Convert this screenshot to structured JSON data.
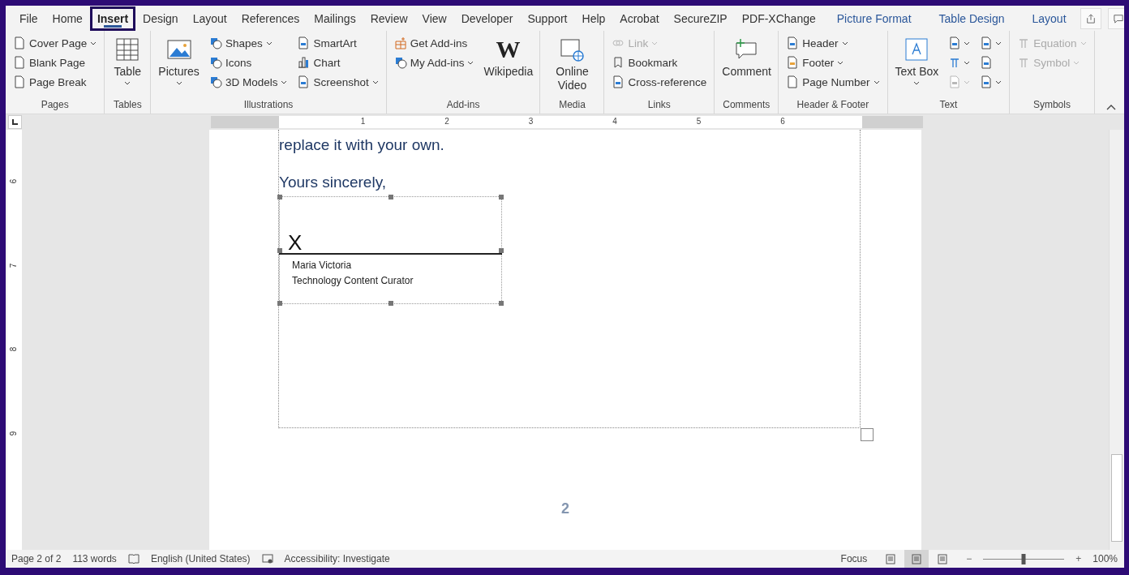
{
  "tabs": [
    {
      "label": "File",
      "kind": "normal",
      "selected": false
    },
    {
      "label": "Home",
      "kind": "normal",
      "selected": false
    },
    {
      "label": "Insert",
      "kind": "normal",
      "selected": true
    },
    {
      "label": "Design",
      "kind": "normal",
      "selected": false
    },
    {
      "label": "Layout",
      "kind": "normal",
      "selected": false
    },
    {
      "label": "References",
      "kind": "normal",
      "selected": false
    },
    {
      "label": "Mailings",
      "kind": "normal",
      "selected": false
    },
    {
      "label": "Review",
      "kind": "normal",
      "selected": false
    },
    {
      "label": "View",
      "kind": "normal",
      "selected": false
    },
    {
      "label": "Developer",
      "kind": "normal",
      "selected": false
    },
    {
      "label": "Support",
      "kind": "normal",
      "selected": false
    },
    {
      "label": "Help",
      "kind": "normal",
      "selected": false
    },
    {
      "label": "Acrobat",
      "kind": "normal",
      "selected": false
    },
    {
      "label": "SecureZIP",
      "kind": "normal",
      "selected": false
    },
    {
      "label": "PDF-XChange",
      "kind": "normal",
      "selected": false
    },
    {
      "label": "Picture Format",
      "kind": "contextual",
      "selected": false
    },
    {
      "label": "Table Design",
      "kind": "contextual",
      "selected": false
    },
    {
      "label": "Layout",
      "kind": "contextual",
      "selected": false
    }
  ],
  "ribbon": [
    {
      "label": "Pages",
      "columns": [
        [
          {
            "kind": "small",
            "label": "Cover Page",
            "dropdown": true,
            "disabled": false
          },
          {
            "kind": "small",
            "label": "Blank Page",
            "dropdown": false,
            "disabled": false
          },
          {
            "kind": "small",
            "label": "Page Break",
            "dropdown": false,
            "disabled": false
          }
        ]
      ]
    },
    {
      "label": "Tables",
      "columns": [
        [
          {
            "kind": "large",
            "label": "Table",
            "dropdown": true,
            "disabled": false
          }
        ]
      ]
    },
    {
      "label": "Illustrations",
      "columns": [
        [
          {
            "kind": "large",
            "label": "Pictures",
            "dropdown": true,
            "disabled": false
          }
        ],
        [
          {
            "kind": "small",
            "label": "Shapes",
            "dropdown": true,
            "disabled": false
          },
          {
            "kind": "small",
            "label": "Icons",
            "dropdown": false,
            "disabled": false
          },
          {
            "kind": "small",
            "label": "3D Models",
            "dropdown": true,
            "disabled": false
          }
        ],
        [
          {
            "kind": "small",
            "label": "SmartArt",
            "dropdown": false,
            "disabled": false
          },
          {
            "kind": "small",
            "label": "Chart",
            "dropdown": false,
            "disabled": false
          },
          {
            "kind": "small",
            "label": "Screenshot",
            "dropdown": true,
            "disabled": false
          }
        ]
      ]
    },
    {
      "label": "Add-ins",
      "columns": [
        [
          {
            "kind": "small",
            "label": "Get Add-ins",
            "dropdown": false,
            "disabled": false
          },
          {
            "kind": "small",
            "label": "My Add-ins",
            "dropdown": true,
            "disabled": false
          }
        ],
        [
          {
            "kind": "large",
            "label": "Wikipedia",
            "logo": "W",
            "dropdown": false,
            "disabled": false
          }
        ]
      ]
    },
    {
      "label": "Media",
      "columns": [
        [
          {
            "kind": "large",
            "label": "Online Video",
            "dropdown": false,
            "disabled": false
          }
        ]
      ]
    },
    {
      "label": "Links",
      "columns": [
        [
          {
            "kind": "small",
            "label": "Link",
            "dropdown": true,
            "disabled": true
          },
          {
            "kind": "small",
            "label": "Bookmark",
            "dropdown": false,
            "disabled": false
          },
          {
            "kind": "small",
            "label": "Cross-reference",
            "dropdown": false,
            "disabled": false
          }
        ]
      ]
    },
    {
      "label": "Comments",
      "columns": [
        [
          {
            "kind": "large",
            "label": "Comment",
            "dropdown": false,
            "disabled": false
          }
        ]
      ]
    },
    {
      "label": "Header & Footer",
      "columns": [
        [
          {
            "kind": "small",
            "label": "Header",
            "dropdown": true,
            "disabled": false
          },
          {
            "kind": "small",
            "label": "Footer",
            "dropdown": true,
            "disabled": false
          },
          {
            "kind": "small",
            "label": "Page Number",
            "dropdown": true,
            "disabled": false
          }
        ]
      ]
    },
    {
      "label": "Text",
      "columns": [
        [
          {
            "kind": "large",
            "label": "Text Box",
            "dropdown": true,
            "disabled": false
          }
        ],
        [
          {
            "kind": "icon",
            "dropdown": true,
            "disabled": false
          },
          {
            "kind": "icon",
            "dropdown": true,
            "disabled": false
          },
          {
            "kind": "icon",
            "dropdown": true,
            "disabled": true
          }
        ],
        [
          {
            "kind": "icon",
            "dropdown": true,
            "disabled": false
          },
          {
            "kind": "icon",
            "dropdown": false,
            "disabled": false
          },
          {
            "kind": "icon",
            "dropdown": true,
            "disabled": false
          }
        ]
      ]
    },
    {
      "label": "Symbols",
      "columns": [
        [
          {
            "kind": "small",
            "label": "Equation",
            "dropdown": true,
            "disabled": true
          },
          {
            "kind": "small",
            "label": "Symbol",
            "dropdown": true,
            "disabled": true
          }
        ]
      ]
    }
  ],
  "ruler": {
    "horizontal": [
      "1",
      "2",
      "3",
      "4",
      "5",
      "6"
    ],
    "vertical": [
      "6",
      "7",
      "8",
      "9"
    ]
  },
  "document": {
    "paragraphs": [
      "replace it with your own.",
      "Yours sincerely,"
    ],
    "signature": {
      "mark": "X",
      "name": "Maria Victoria",
      "title": "Technology Content Curator"
    },
    "page_number": "2"
  },
  "status_bar": {
    "page": "Page 2 of 2",
    "words": "113 words",
    "language": "English (United States)",
    "accessibility": "Accessibility: Investigate",
    "focus": "Focus",
    "views": [
      {
        "selected": false
      },
      {
        "selected": true
      },
      {
        "selected": false
      }
    ],
    "zoom": {
      "out": "−",
      "level": 0.5,
      "in": "+",
      "reading": "100%"
    }
  }
}
